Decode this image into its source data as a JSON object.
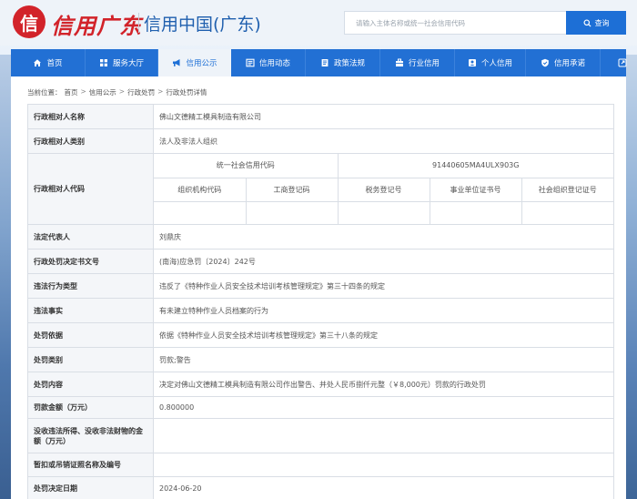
{
  "header": {
    "logo_mark": "信",
    "logo_script": "信用广东",
    "logo_sub": "信用中国(广东)",
    "search_placeholder": "请输入主体名称或统一社会信用代码",
    "search_button": "查询"
  },
  "nav": {
    "items": [
      {
        "label": "首页",
        "icon": "home-icon"
      },
      {
        "label": "服务大厅",
        "icon": "grid-icon"
      },
      {
        "label": "信用公示",
        "icon": "announce-icon",
        "active": true
      },
      {
        "label": "信用动态",
        "icon": "news-icon"
      },
      {
        "label": "政策法规",
        "icon": "policy-icon"
      },
      {
        "label": "行业信用",
        "icon": "industry-icon"
      },
      {
        "label": "个人信用",
        "icon": "person-icon"
      },
      {
        "label": "信用承诺",
        "icon": "shield-icon"
      }
    ],
    "extra_icon": "external-icon"
  },
  "breadcrumb": {
    "prefix": "当前位置：",
    "items": [
      "首页",
      "信用公示",
      "行政处罚",
      "行政处罚详情"
    ],
    "separator": ">"
  },
  "detail": {
    "name_label": "行政相对人名称",
    "name_value": "佛山文德精工模具制造有限公司",
    "category_label": "行政相对人类别",
    "category_value": "法人及非法人组织",
    "code_label": "行政相对人代码",
    "uscc_label": "统一社会信用代码",
    "uscc_value": "91440605MA4ULX903G",
    "sub_codes": [
      "组织机构代码",
      "工商登记码",
      "税务登记号",
      "事业单位证书号",
      "社会组织登记证号"
    ],
    "legal_rep_label": "法定代表人",
    "legal_rep_value": "刘鼎庆",
    "doc_no_label": "行政处罚决定书文号",
    "doc_no_value": "(南海)应急罚〔2024〕242号",
    "violation_type_label": "违法行为类型",
    "violation_type_value": "违反了《特种作业人员安全技术培训考核管理规定》第三十四条的规定",
    "violation_fact_label": "违法事实",
    "violation_fact_value": "有未建立特种作业人员档案的行为",
    "basis_label": "处罚依据",
    "basis_value": "依据《特种作业人员安全技术培训考核管理规定》第三十八条的规定",
    "penalty_type_label": "处罚类别",
    "penalty_type_value": "罚款;警告",
    "penalty_content_label": "处罚内容",
    "penalty_content_value": "决定对佛山文德精工模具制造有限公司作出警告、并处人民币捌仟元整（￥8,000元）罚款的行政处罚",
    "fine_label": "罚款金额（万元）",
    "fine_value": "0.800000",
    "confiscation_label": "没收违法所得、没收非法财物的金额（万元）",
    "confiscation_value": "",
    "license_label": "暂扣或吊销证照名称及编号",
    "license_value": "",
    "decision_date_label": "处罚决定日期",
    "decision_date_value": "2024-06-20"
  }
}
